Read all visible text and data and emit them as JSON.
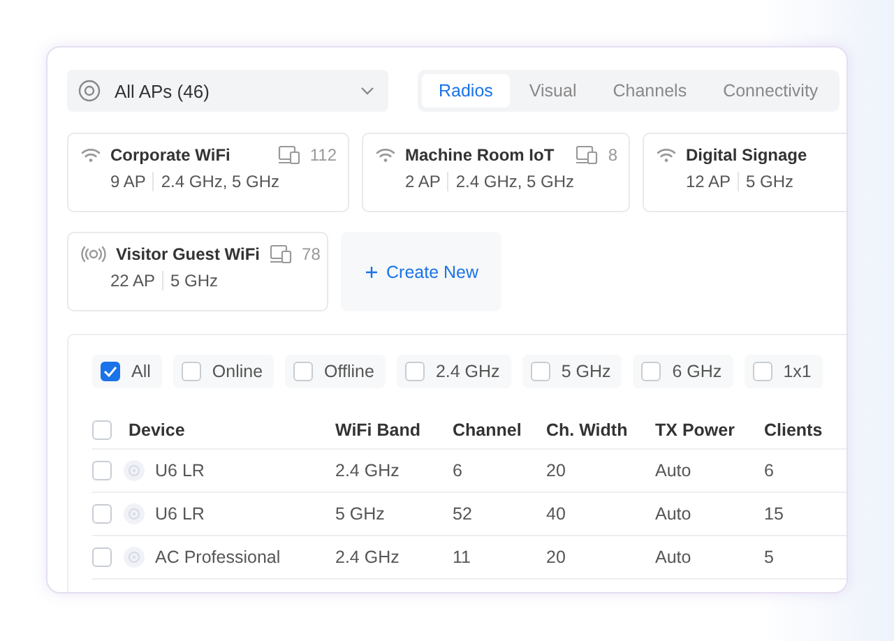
{
  "ap_filter": {
    "label": "All APs (46)"
  },
  "tabs": [
    {
      "label": "Radios",
      "selected": true
    },
    {
      "label": "Visual",
      "selected": false
    },
    {
      "label": "Channels",
      "selected": false
    },
    {
      "label": "Connectivity",
      "selected": false
    }
  ],
  "networks": [
    {
      "kind": "wifi",
      "name": "Corporate WiFi",
      "clients": "112",
      "aps": "9 AP",
      "bands": "2.4 GHz, 5 GHz"
    },
    {
      "kind": "wifi",
      "name": "Machine Room IoT",
      "clients": "8",
      "aps": "2 AP",
      "bands": "2.4 GHz, 5 GHz"
    },
    {
      "kind": "wifi",
      "name": "Digital Signage",
      "aps": "12 AP",
      "bands": "5 GHz"
    },
    {
      "kind": "broadcast",
      "name": "Visitor Guest WiFi",
      "clients": "78",
      "aps": "22 AP",
      "bands": "5 GHz"
    }
  ],
  "create_button": {
    "label": "Create New"
  },
  "filters": [
    {
      "label": "All",
      "checked": true
    },
    {
      "label": "Online",
      "checked": false
    },
    {
      "label": "Offline",
      "checked": false
    },
    {
      "label": "2.4 GHz",
      "checked": false
    },
    {
      "label": "5 GHz",
      "checked": false
    },
    {
      "label": "6 GHz",
      "checked": false
    },
    {
      "label": "1x1",
      "checked": false
    }
  ],
  "table": {
    "select_all_checked": false,
    "columns": [
      "Device",
      "WiFi Band",
      "Channel",
      "Ch. Width",
      "TX Power",
      "Clients"
    ],
    "rows": [
      {
        "checked": false,
        "cells": [
          "U6 LR",
          "2.4 GHz",
          "6",
          "20",
          "Auto",
          "6"
        ]
      },
      {
        "checked": false,
        "cells": [
          "U6 LR",
          "5 GHz",
          "52",
          "40",
          "Auto",
          "15"
        ]
      },
      {
        "checked": false,
        "cells": [
          "AC Professional",
          "2.4 GHz",
          "11",
          "20",
          "Auto",
          "5"
        ]
      }
    ]
  }
}
